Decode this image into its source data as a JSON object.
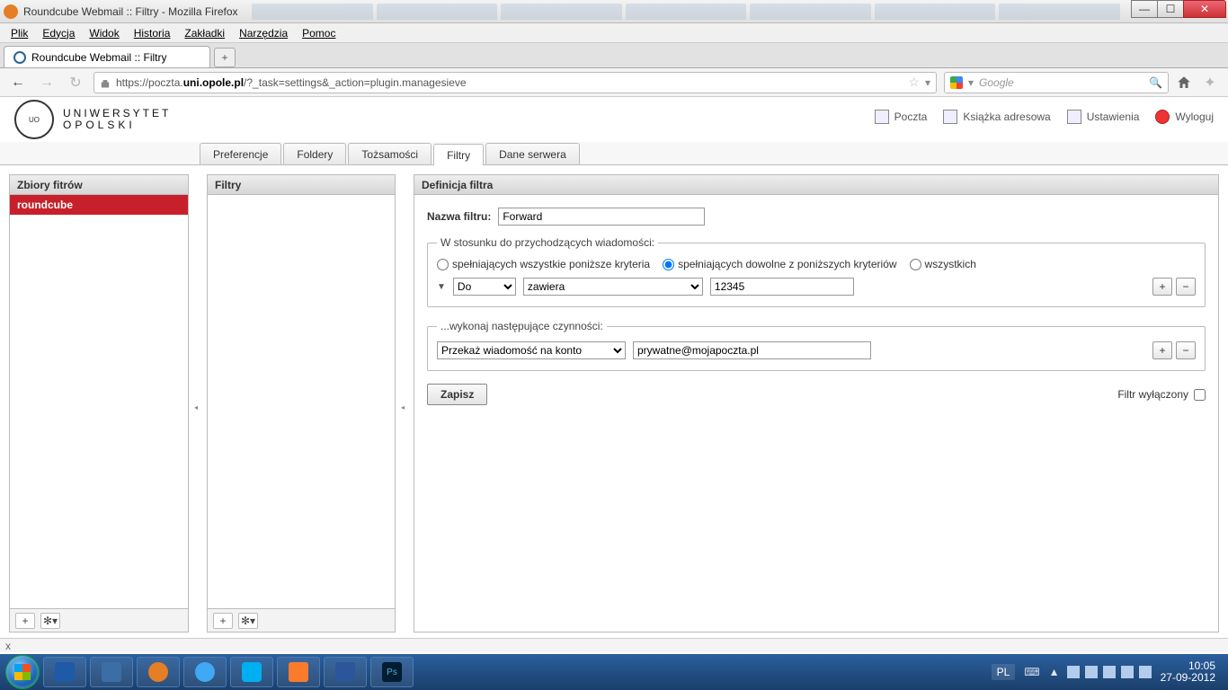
{
  "window": {
    "title": "Roundcube Webmail :: Filtry - Mozilla Firefox"
  },
  "ff_menu": [
    "Plik",
    "Edycja",
    "Widok",
    "Historia",
    "Zakładki",
    "Narzędzia",
    "Pomoc"
  ],
  "browser_tab": {
    "title": "Roundcube Webmail :: Filtry"
  },
  "url": {
    "prefix": "https://poczta.",
    "bold": "uni.opole.pl",
    "suffix": "/?_task=settings&_action=plugin.managesieve"
  },
  "search": {
    "placeholder": "Google"
  },
  "logo": {
    "line1": "UNIWERSYTET",
    "line2": "OPOLSKI"
  },
  "header_links": {
    "mail": "Poczta",
    "book": "Książka adresowa",
    "settings": "Ustawienia",
    "logout": "Wyloguj"
  },
  "tabs": {
    "prefs": "Preferencje",
    "folders": "Foldery",
    "ident": "Tożsamości",
    "filters": "Filtry",
    "server": "Dane serwera"
  },
  "panels": {
    "sets": "Zbiory fitrów",
    "filters": "Filtry",
    "def": "Definicja filtra"
  },
  "sets_list": {
    "item0": "roundcube"
  },
  "form": {
    "name_label": "Nazwa filtru:",
    "name_value": "Forward",
    "scope_legend": "W stosunku do przychodzących wiadomości:",
    "radio_all": "spełniających wszystkie poniższe kryteria",
    "radio_any": "spełniających dowolne z poniższych kryteriów",
    "radio_every": "wszystkich",
    "rule_field": "Do",
    "rule_op": "zawiera",
    "rule_value": "12345",
    "actions_legend": "...wykonaj następujące czynności:",
    "action_type": "Przekaż wiadomość na konto",
    "action_target": "prywatne@mojapoczta.pl",
    "save": "Zapisz",
    "disabled": "Filtr wyłączony"
  },
  "statusbar": "x",
  "tray": {
    "lang": "PL",
    "time": "10:05",
    "date": "27-09-2012"
  }
}
